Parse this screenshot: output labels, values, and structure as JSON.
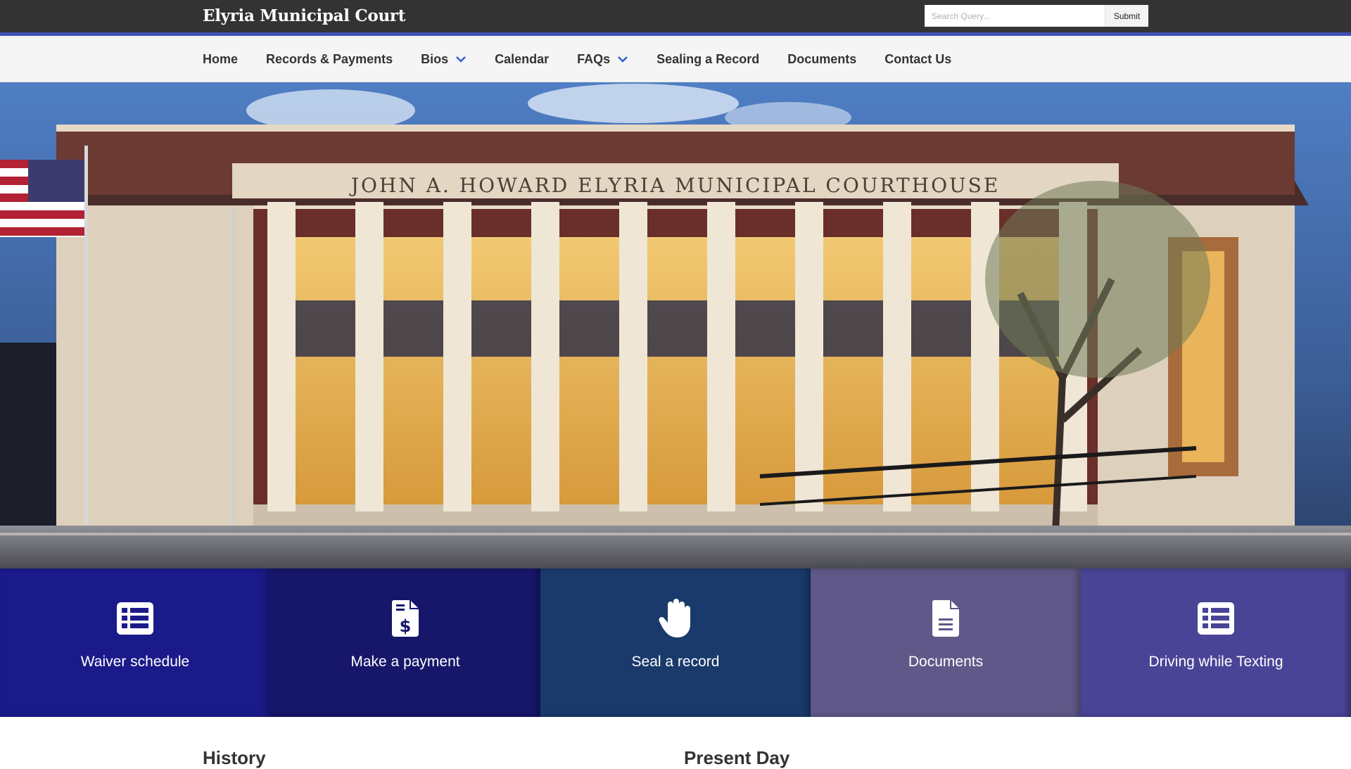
{
  "header": {
    "site_title": "Elyria Municipal Court",
    "search_placeholder": "Search Query...",
    "search_button": "Submit"
  },
  "nav": {
    "items": [
      {
        "label": "Home",
        "has_dropdown": false
      },
      {
        "label": "Records & Payments",
        "has_dropdown": false
      },
      {
        "label": "Bios",
        "has_dropdown": true
      },
      {
        "label": "Calendar",
        "has_dropdown": false
      },
      {
        "label": "FAQs",
        "has_dropdown": true
      },
      {
        "label": "Sealing a Record",
        "has_dropdown": false
      },
      {
        "label": "Documents",
        "has_dropdown": false
      },
      {
        "label": "Contact Us",
        "has_dropdown": false
      }
    ],
    "chevron_color": "#2a5fd0"
  },
  "hero": {
    "building_inscription": "JOHN A. HOWARD ELYRIA MUNICIPAL COURTHOUSE"
  },
  "tiles": [
    {
      "label": "Waiver schedule",
      "icon": "list-icon",
      "color": "#1a1a8a"
    },
    {
      "label": "Make a payment",
      "icon": "invoice-dollar-icon",
      "color": "#16166b"
    },
    {
      "label": "Seal a record",
      "icon": "hand-icon",
      "color": "#1a3a6b"
    },
    {
      "label": "Documents",
      "icon": "document-icon",
      "color": "#5f5888"
    },
    {
      "label": "Driving while Texting",
      "icon": "list-icon",
      "color": "#4a4496"
    }
  ],
  "sections": {
    "history_heading": "History",
    "present_heading": "Present Day"
  }
}
